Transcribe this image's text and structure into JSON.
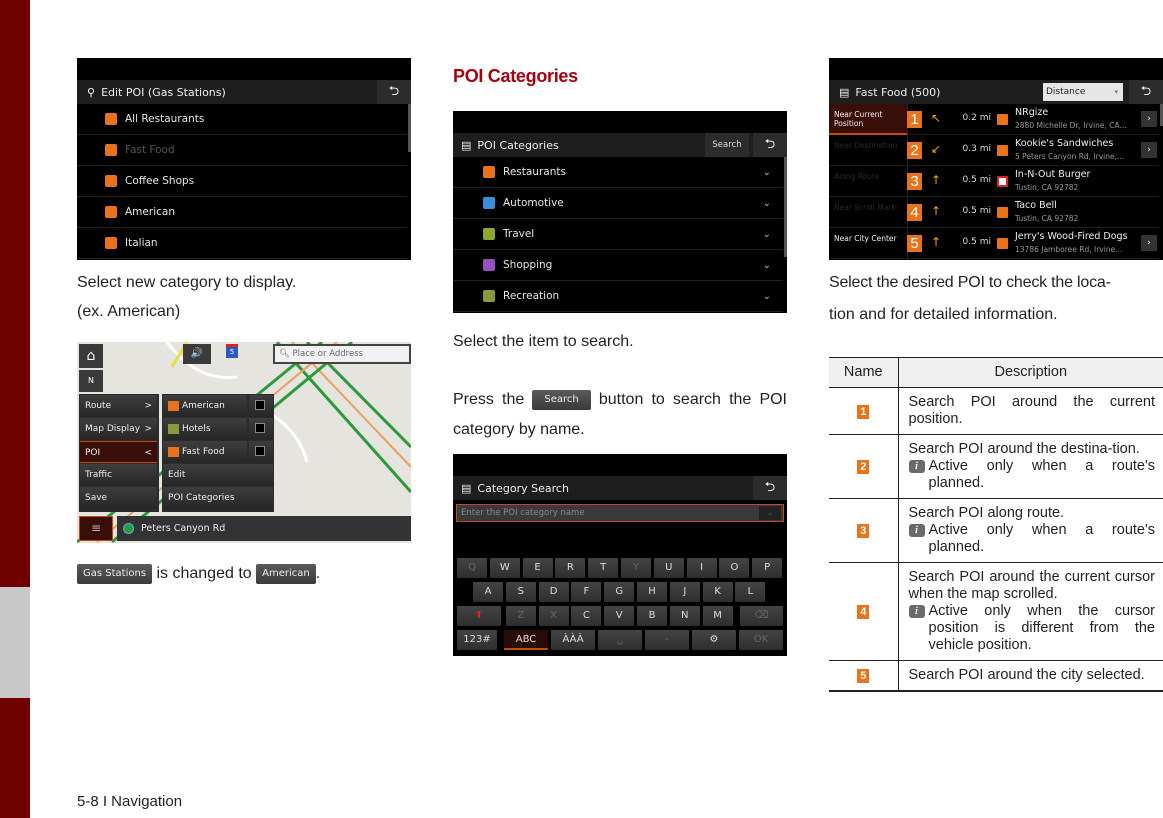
{
  "footer": "5-8 I Navigation",
  "col1": {
    "screen1": {
      "title": "Edit POI (Gas Stations)",
      "items": [
        {
          "label": "All Restaurants",
          "color": "#e8731a",
          "dim": false
        },
        {
          "label": "Fast Food",
          "color": "#e8731a",
          "dim": true
        },
        {
          "label": "Coffee Shops",
          "color": "#e8731a",
          "dim": false
        },
        {
          "label": "American",
          "color": "#e8731a",
          "dim": false
        },
        {
          "label": "Italian",
          "color": "#e8731a",
          "dim": false
        }
      ]
    },
    "text1": "Select new category to display.",
    "text2": "(ex. American)",
    "map": {
      "search_placeholder": "Place or Address",
      "menu": [
        "Route",
        "Map Display",
        "POI",
        "Traffic",
        "Save"
      ],
      "menu_arrows": [
        ">",
        ">",
        "<",
        "",
        ""
      ],
      "submenu": [
        {
          "label": "American",
          "color": "#e8731a",
          "check": true
        },
        {
          "label": "Hotels",
          "color": "#8a9a3a",
          "check": true
        },
        {
          "label": "Fast Food",
          "color": "#e8731a",
          "check": true
        },
        {
          "label": "Edit",
          "color": null,
          "check": false
        },
        {
          "label": "POI Categories",
          "color": null,
          "check": false
        }
      ],
      "street": "Peters Canyon Rd",
      "highway": "5"
    },
    "change": {
      "from_chip": "Gas Stations",
      "middle": " is changed to ",
      "to_chip": "American",
      "end": "."
    }
  },
  "col2": {
    "heading": "POI Categories",
    "screen2": {
      "title": "POI Categories",
      "search_btn": "Search",
      "items": [
        {
          "label": "Restaurants",
          "color": "#e8731a"
        },
        {
          "label": "Automotive",
          "color": "#3b8ed8"
        },
        {
          "label": "Travel",
          "color": "#8aa832"
        },
        {
          "label": "Shopping",
          "color": "#9a4fc0"
        },
        {
          "label": "Recreation",
          "color": "#8a9a3a"
        }
      ]
    },
    "text1": "Select the item to search.",
    "text2_pre": "Press the ",
    "text2_chip": "Search",
    "text2_post": " button to search the POI category by name.",
    "screen3": {
      "title": "Category Search",
      "placeholder": "Enter the POI category name",
      "rows": [
        [
          "Q",
          "W",
          "E",
          "R",
          "T",
          "Y",
          "U",
          "I",
          "O",
          "P"
        ],
        [
          "A",
          "S",
          "D",
          "F",
          "G",
          "H",
          "J",
          "K",
          "L"
        ],
        [
          "⬆",
          "Z",
          "X",
          "C",
          "V",
          "B",
          "N",
          "M",
          "⌫"
        ],
        [
          "123#",
          "ABC",
          "ÀÀÀ",
          "␣",
          "-",
          "⚙",
          "OK"
        ]
      ],
      "dim_keys": [
        "Q",
        "Y",
        "Z",
        "X",
        "⌫",
        "␣",
        "-",
        "OK"
      ]
    }
  },
  "col3": {
    "screen4": {
      "title": "Fast Food (500)",
      "sort": "Distance",
      "left_labels": [
        {
          "text": "Near Current Position",
          "state": "active"
        },
        {
          "text": "Near Destination",
          "state": "dim"
        },
        {
          "text": "Along Route",
          "state": "dim"
        },
        {
          "text": "Near Scroll Mark",
          "state": "dim"
        },
        {
          "text": "Near City Center",
          "state": "normal"
        }
      ],
      "results": [
        {
          "n": "1",
          "arrow": "↖",
          "dist": "0.2 mi",
          "name": "NRgize",
          "addr": "2880 Michelle Dr, Irvine, CA...",
          "icon": "fastfood",
          "go": true
        },
        {
          "n": "2",
          "arrow": "↙",
          "dist": "0.3 mi",
          "name": "Kookie's Sandwiches",
          "addr": "5 Peters Canyon Rd, Irvine,...",
          "icon": "fastfood",
          "go": true
        },
        {
          "n": "3",
          "arrow": "↑",
          "dist": "0.5 mi",
          "name": "In-N-Out Burger",
          "addr": "Tustin, CA 92782",
          "icon": "innout",
          "go": false
        },
        {
          "n": "4",
          "arrow": "↑",
          "dist": "0.5 mi",
          "name": "Taco Bell",
          "addr": "Tustin, CA 92782",
          "icon": "fastfood",
          "go": false
        },
        {
          "n": "5",
          "arrow": "↑",
          "dist": "0.5 mi",
          "name": "Jerry's Wood-Fired Dogs",
          "addr": "13786 Jamboree Rd, Irvine...",
          "icon": "fastfood",
          "go": true
        }
      ]
    },
    "text": "Select the desired POI to check the loca-tion and for detailed information.",
    "text_line1": "Select the desired POI to check the loca-",
    "text_line2": "tion and for detailed information.",
    "table": {
      "headers": [
        "Name",
        "Description"
      ],
      "rows": [
        {
          "badge": "1",
          "desc": "Search POI around the current position.",
          "note": ""
        },
        {
          "badge": "2",
          "desc": "Search POI around the destina-tion.",
          "note": "Active only when a route's planned."
        },
        {
          "badge": "3",
          "desc": "Search POI along route.",
          "note": "Active only when a route's planned."
        },
        {
          "badge": "4",
          "desc": "Search POI around the current cursor when the map scrolled.",
          "note": "Active only when the cursor position is different from the vehicle position."
        },
        {
          "badge": "5",
          "desc": "Search POI around the city selected.",
          "note": ""
        }
      ]
    }
  },
  "colors": {
    "accent_red": "#a6000f",
    "band": "#6e0000",
    "badge_orange": "#e8731a"
  }
}
